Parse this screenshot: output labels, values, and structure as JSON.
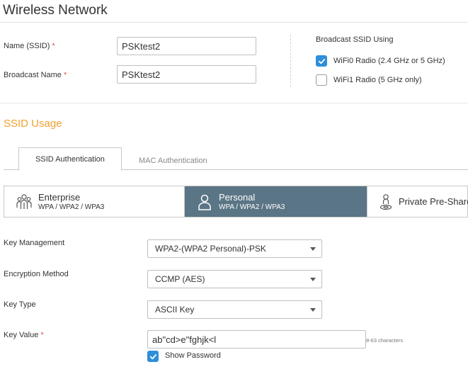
{
  "page": {
    "title": "Wireless Network"
  },
  "ssid": {
    "name_label": "Name (SSID)",
    "name_value": "PSKtest2",
    "broadcast_label": "Broadcast Name",
    "broadcast_value": "PSKtest2",
    "required_mark": "*"
  },
  "broadcast": {
    "heading": "Broadcast SSID Using",
    "options": [
      {
        "label": "WiFi0 Radio (2.4 GHz or 5 GHz)",
        "checked": true
      },
      {
        "label": "WiFi1 Radio (5 GHz only)",
        "checked": false
      }
    ]
  },
  "usage": {
    "title": "SSID Usage"
  },
  "tabs": [
    {
      "label": "SSID Authentication",
      "active": true
    },
    {
      "label": "MAC Authentication",
      "active": false
    }
  ],
  "auth_modes": [
    {
      "label": "Enterprise",
      "sub": "WPA / WPA2 / WPA3",
      "icon": "users-group-icon",
      "selected": false
    },
    {
      "label": "Personal",
      "sub": "WPA / WPA2 / WPA3",
      "icon": "user-icon",
      "selected": true
    },
    {
      "label": "Private Pre-Shared",
      "sub": "",
      "icon": "user-pin-icon",
      "selected": false
    }
  ],
  "form": {
    "key_management_label": "Key Management",
    "key_management_value": "WPA2-(WPA2 Personal)-PSK",
    "encryption_label": "Encryption Method",
    "encryption_value": "CCMP (AES)",
    "key_type_label": "Key Type",
    "key_type_value": "ASCII Key",
    "key_value_label": "Key Value",
    "key_value_value": "ab\"cd>e\"fghjk<l",
    "key_value_hint": "8-63 characters",
    "show_password_label": "Show Password",
    "show_password_checked": true
  },
  "colors": {
    "accent_orange": "#f0a030",
    "selected_segment": "#5a7585",
    "checkbox_blue": "#2f8fd8",
    "required_red": "#d9534f"
  }
}
